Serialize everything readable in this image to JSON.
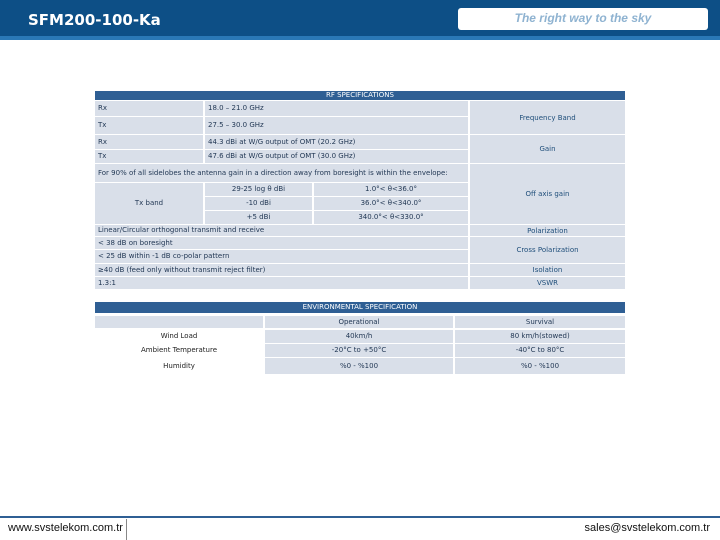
{
  "header": {
    "title": "SFM200-100-Ka",
    "tagline": "The right way to the sky"
  },
  "rf": {
    "section_title": "RF SPECIFICATIONS",
    "freq": {
      "rx_label": "Rx",
      "rx_value": "18.0 – 21.0 GHz",
      "tx_label": "Tx",
      "tx_value": "27.5 – 30.0 GHz",
      "right_label": "Frequency Band"
    },
    "gain": {
      "rx_label": "Rx",
      "rx_value": "44.3 dBi at W/G output of OMT (20.2 GHz)",
      "tx_label": "Tx",
      "tx_value": "47.6 dBi at W/G output of OMT (30.0 GHz)",
      "right_label": "Gain"
    },
    "offaxis": {
      "description": "For 90% of all sidelobes the antenna gain in a direction away from boresight is within the envelope:",
      "band_label": "Tx band",
      "rows": [
        {
          "gain": "29-25 log θ dBi",
          "range": "1.0°< θ<36.0°"
        },
        {
          "gain": "-10 dBi",
          "range": "36.0°< θ<340.0°"
        },
        {
          "gain": "+5 dBi",
          "range": "340.0°< θ<330.0°"
        }
      ],
      "right_label": "Off axis gain"
    },
    "polarization": {
      "value": "Linear/Circular orthogonal transmit and receive",
      "right_label": "Polarization"
    },
    "cross_pol": {
      "line1": "< 38 dB on boresight",
      "line2": "< 25 dB within -1 dB co-polar pattern",
      "right_label": "Cross Polarization"
    },
    "isolation": {
      "value": "≥40 dB (feed only without transmit reject filter)",
      "right_label": "Isolation"
    },
    "vswr": {
      "value": "1.3:1",
      "right_label": "VSWR"
    }
  },
  "env": {
    "section_title": "ENVIRONMENTAL SPECIFICATION",
    "col_operational": "Operational",
    "col_survival": "Survival",
    "rows": [
      {
        "label": "Wind Load",
        "operational": "40km/h",
        "survival": "80 km/h(stowed)"
      },
      {
        "label": "Ambient Temperature",
        "operational": "-20°C to +50°C",
        "survival": "-40°C to 80°C"
      },
      {
        "label": "Humidity",
        "operational": "%0 - %100",
        "survival": "%0 - %100"
      }
    ]
  },
  "footer": {
    "website": "www.svstelekom.com.tr",
    "email": "sales@svstelekom.com.tr"
  },
  "colors": {
    "header_blue": "#0d4f86",
    "band_blue": "#2f5f94",
    "cell_gray": "#d9dfe9"
  }
}
